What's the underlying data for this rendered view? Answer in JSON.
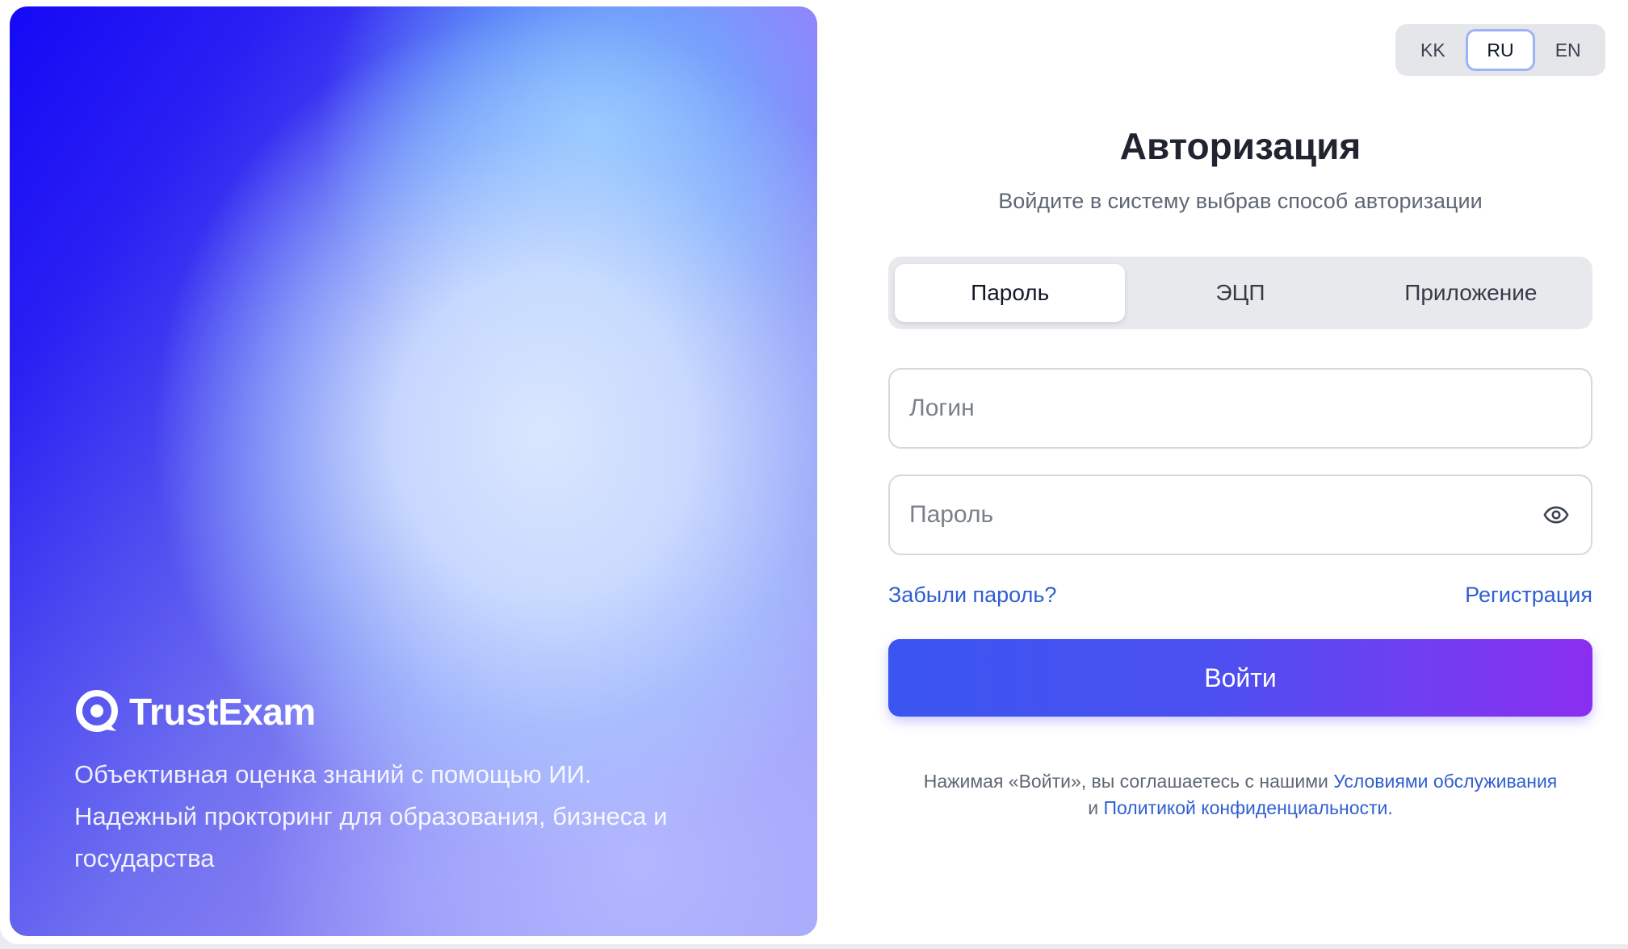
{
  "hero": {
    "brand_name": "TrustExam",
    "tagline_line1": "Объективная оценка знаний с помощью ИИ.",
    "tagline_line2": "Надежный прокторинг для образования, бизнеса и",
    "tagline_line3": "государства"
  },
  "language": {
    "options": [
      "KK",
      "RU",
      "EN"
    ],
    "selected": "RU"
  },
  "form": {
    "title": "Авторизация",
    "subtitle": "Войдите в систему выбрав способ авторизации",
    "tabs": [
      {
        "label": "Пароль",
        "active": true
      },
      {
        "label": "ЭЦП",
        "active": false
      },
      {
        "label": "Приложение",
        "active": false
      }
    ],
    "login_placeholder": "Логин",
    "login_value": "",
    "password_placeholder": "Пароль",
    "password_value": "",
    "password_toggle_icon": "eye-icon",
    "forgot_label": "Забыли пароль?",
    "register_label": "Регистрация",
    "submit_label": "Войти",
    "legal_prefix": "Нажимая «Войти», вы соглашаетесь с нашими",
    "legal_terms_link": "Условиями обслуживания",
    "legal_and": "и",
    "legal_privacy_link": "Политикой конфиденциальности",
    "legal_suffix": "."
  },
  "colors": {
    "accent": "#2f5fd0",
    "button_start": "#3a55f0",
    "button_end": "#8a2ef0"
  }
}
